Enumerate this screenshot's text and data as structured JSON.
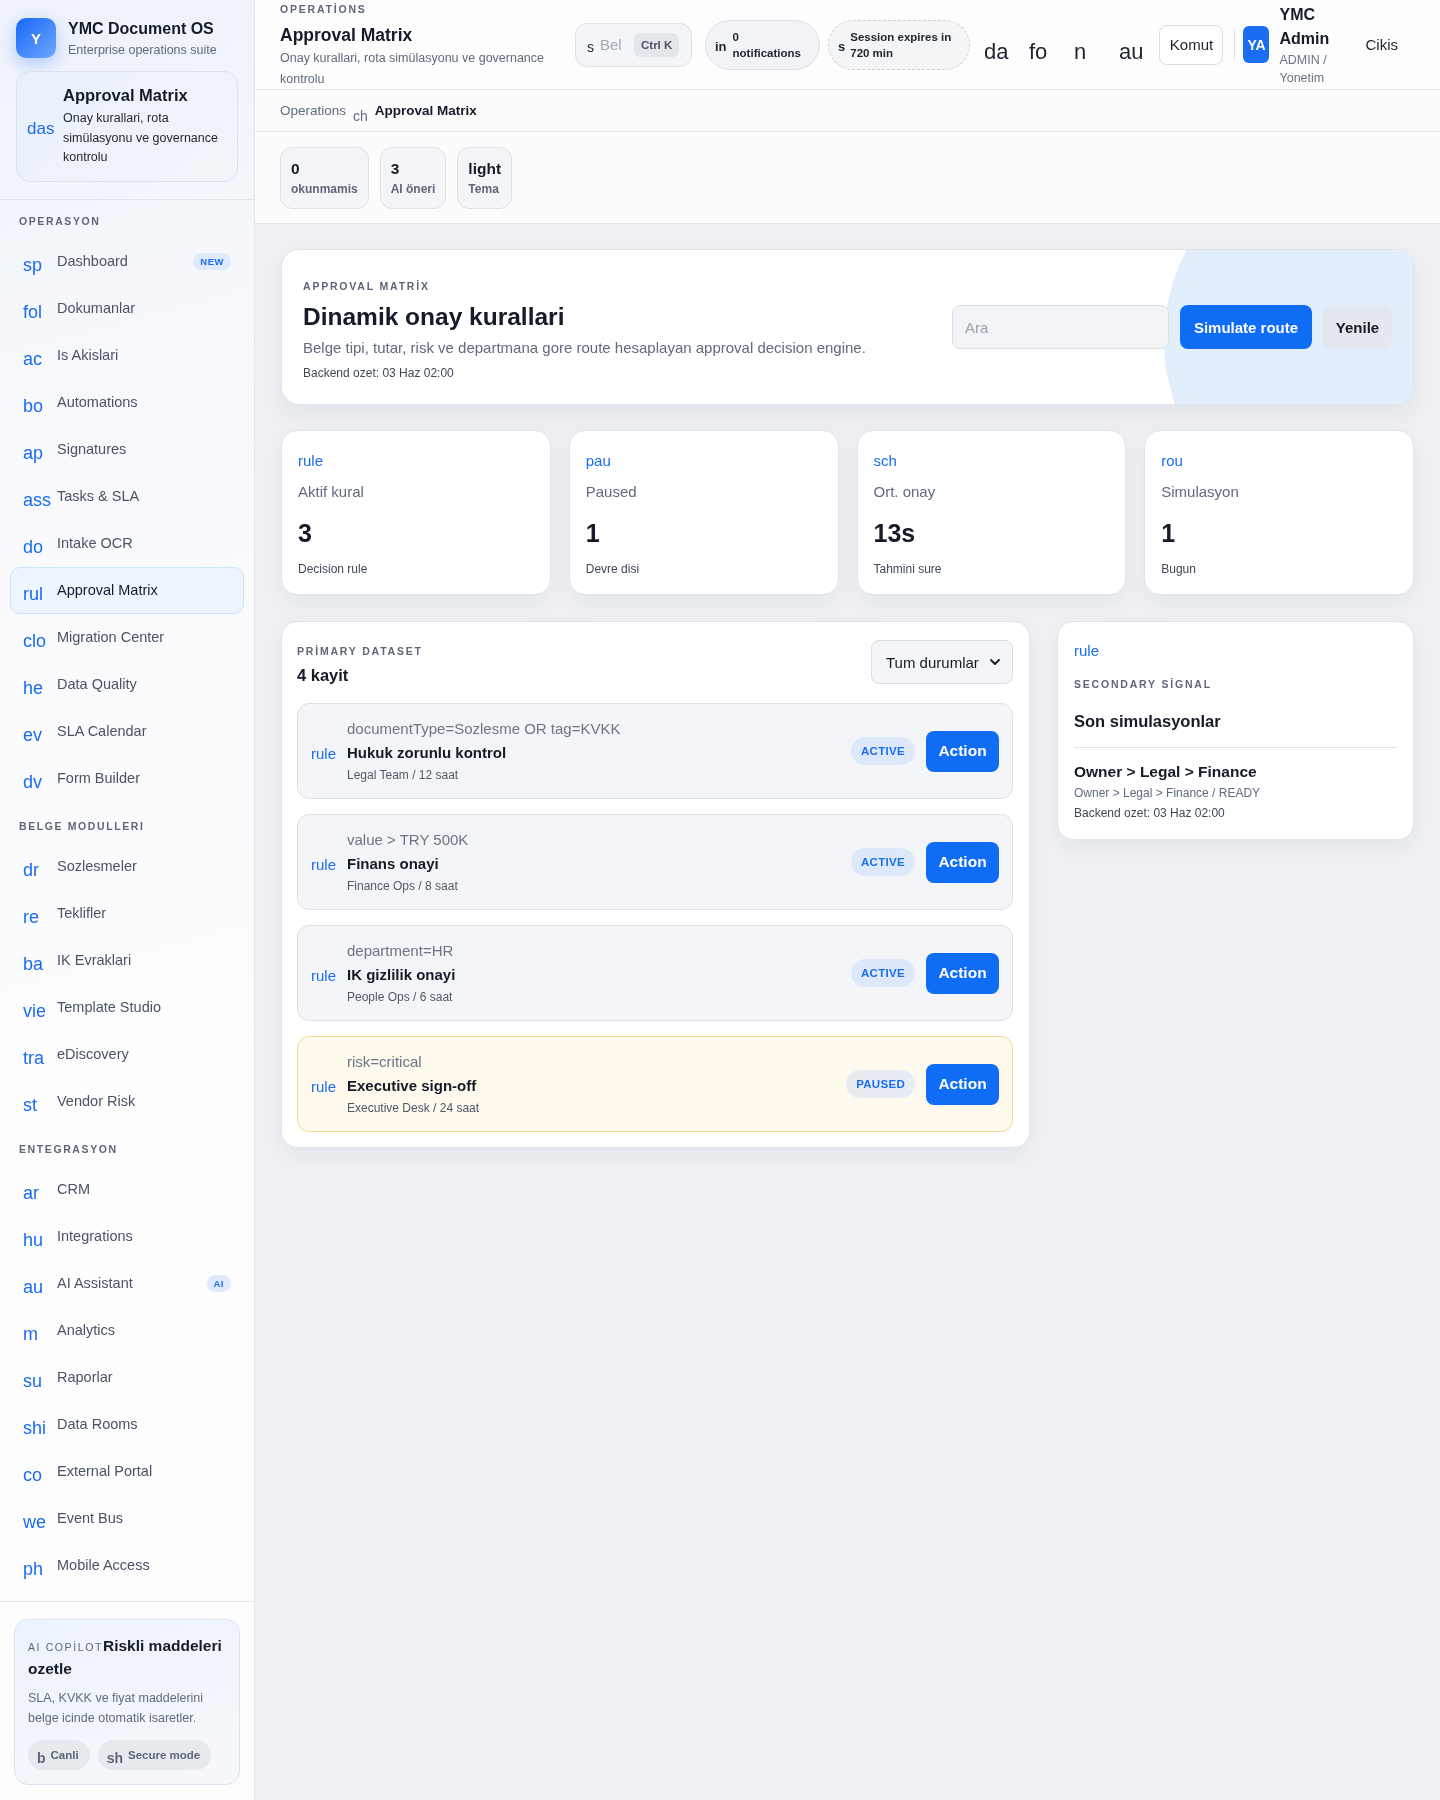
{
  "sidebar": {
    "brand": {
      "logo": "Y",
      "title": "YMC Document OS",
      "subtitle": "Enterprise operations suite"
    },
    "current": {
      "icon": "das",
      "title": "Approval Matrix",
      "description": "Onay kurallari, rota simülasyonu ve governance kontrolu"
    },
    "sections": [
      {
        "title": "OPERASYON",
        "items": [
          {
            "icon": "sp",
            "label": "Dashboard",
            "badge": "NEW",
            "selected": false
          },
          {
            "icon": "fol",
            "label": "Dokumanlar",
            "selected": false
          },
          {
            "icon": "ac",
            "label": "Is Akislari",
            "selected": false
          },
          {
            "icon": "bo",
            "label": "Automations",
            "selected": false
          },
          {
            "icon": "ap",
            "label": "Signatures",
            "selected": false
          },
          {
            "icon": "ass",
            "label": "Tasks & SLA",
            "selected": false
          },
          {
            "icon": "do",
            "label": "Intake OCR",
            "selected": false
          },
          {
            "icon": "rul",
            "label": "Approval Matrix",
            "selected": true
          },
          {
            "icon": "clo",
            "label": "Migration Center",
            "selected": false
          },
          {
            "icon": "he",
            "label": "Data Quality",
            "selected": false
          },
          {
            "icon": "ev",
            "label": "SLA Calendar",
            "selected": false
          },
          {
            "icon": "dv",
            "label": "Form Builder",
            "selected": false
          }
        ]
      },
      {
        "title": "BELGE MODULLERI",
        "items": [
          {
            "icon": "dr",
            "label": "Sozlesmeler",
            "selected": false
          },
          {
            "icon": "re",
            "label": "Teklifler",
            "selected": false
          },
          {
            "icon": "ba",
            "label": "IK Evraklari",
            "selected": false
          },
          {
            "icon": "vie",
            "label": "Template Studio",
            "selected": false
          },
          {
            "icon": "tra",
            "label": "eDiscovery",
            "selected": false
          },
          {
            "icon": "st",
            "label": "Vendor Risk",
            "selected": false
          }
        ]
      },
      {
        "title": "ENTEGRASYON",
        "items": [
          {
            "icon": "ar",
            "label": "CRM",
            "selected": false
          },
          {
            "icon": "hu",
            "label": "Integrations",
            "selected": false
          },
          {
            "icon": "au",
            "label": "AI Assistant",
            "badge": "AI",
            "selected": false
          },
          {
            "icon": "m",
            "label": "Analytics",
            "selected": false
          },
          {
            "icon": "su",
            "label": "Raporlar",
            "selected": false
          },
          {
            "icon": "shi",
            "label": "Data Rooms",
            "selected": false
          },
          {
            "icon": "co",
            "label": "External Portal",
            "selected": false
          },
          {
            "icon": "we",
            "label": "Event Bus",
            "selected": false
          },
          {
            "icon": "ph",
            "label": "Mobile Access",
            "selected": false
          }
        ]
      }
    ],
    "copilot": {
      "eyebrow": "AI COPİLOT",
      "title": "Riskli maddeleri ozetle",
      "description": "SLA, KVKK ve fiyat maddelerini belge icinde otomatik isaretler.",
      "chips": [
        {
          "icon": "b",
          "label": "Canli"
        },
        {
          "icon": "sh",
          "label": "Secure mode"
        }
      ]
    }
  },
  "topbar": {
    "eyebrow": "OPERATİONS",
    "title": "Approval Matrix",
    "description": "Onay kurallari, rota simülasyonu ve governance kontrolu",
    "search": {
      "icon": "s",
      "placeholder": "Bel",
      "shortcut": "Ctrl K"
    },
    "notifications": {
      "icon": "in",
      "label": "0 notifications"
    },
    "session": {
      "icon": "s",
      "label": "Session expires in 720 min"
    },
    "tools": [
      "da",
      "fo",
      "n",
      "au"
    ],
    "command": "Komut",
    "user": {
      "initials": "YA",
      "name": "YMC Admin",
      "role": "ADMIN / Yonetim"
    },
    "logout": "Cikis"
  },
  "breadcrumb": {
    "root": "Operations",
    "separator_icon": "ch",
    "current": "Approval Matrix"
  },
  "header_stats": [
    {
      "value": "0",
      "label": "okunmamis"
    },
    {
      "value": "3",
      "label": "AI öneri"
    },
    {
      "value": "light",
      "label": "Tema"
    }
  ],
  "hero": {
    "eyebrow": "APPROVAL MATRİX",
    "title": "Dinamik onay kurallari",
    "description": "Belge tipi, tutar, risk ve departmana gore route hesaplayan approval decision engine.",
    "meta": "Backend ozet: 03 Haz 02:00",
    "search": {
      "placeholder": "Ara"
    },
    "buttons": [
      {
        "label": "Simulate route",
        "kind": "primary"
      },
      {
        "label": "Yenile",
        "kind": "secondary"
      }
    ]
  },
  "stats": [
    {
      "icon": "rule",
      "label": "Aktif kural",
      "value": "3",
      "note": "Decision rule"
    },
    {
      "icon": "pau",
      "label": "Paused",
      "value": "1",
      "note": "Devre disi"
    },
    {
      "icon": "sch",
      "label": "Ort. onay",
      "value": "13s",
      "note": "Tahmini sure"
    },
    {
      "icon": "rou",
      "label": "Simulasyon",
      "value": "1",
      "note": "Bugun"
    }
  ],
  "dataset": {
    "eyebrow": "PRİMARY DATASET",
    "count": "4 kayit",
    "filter": {
      "value": "Tum durumlar"
    },
    "rows": [
      {
        "icon": "rule",
        "condition": "documentType=Sozlesme OR tag=KVKK",
        "title": "Hukuk zorunlu kontrol",
        "meta": "Legal Team / 12 saat",
        "status": "ACTIVE",
        "kind": "active",
        "action": "Action"
      },
      {
        "icon": "rule",
        "condition": "value > TRY 500K",
        "title": "Finans onayi",
        "meta": "Finance Ops / 8 saat",
        "status": "ACTIVE",
        "kind": "active",
        "action": "Action"
      },
      {
        "icon": "rule",
        "condition": "department=HR",
        "title": "IK gizlilik onayi",
        "meta": "People Ops / 6 saat",
        "status": "ACTIVE",
        "kind": "active",
        "action": "Action"
      },
      {
        "icon": "rule",
        "condition": "risk=critical",
        "title": "Executive sign-off",
        "meta": "Executive Desk / 24 saat",
        "status": "PAUSED",
        "kind": "paused",
        "action": "Action"
      }
    ]
  },
  "signal": {
    "icon": "rule",
    "eyebrow": "SECONDARY SİGNAL",
    "title": "Son simulasyonlar",
    "items": [
      {
        "title": "Owner > Legal > Finance",
        "detail": "Owner > Legal > Finance / READY",
        "meta": "Backend ozet: 03 Haz 02:00"
      }
    ]
  }
}
